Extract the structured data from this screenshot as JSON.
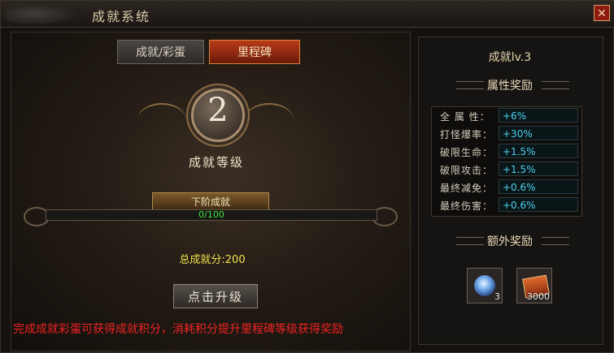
{
  "window": {
    "title": "成就系统",
    "close_glyph": "✕"
  },
  "tabs": [
    {
      "label": "成就/彩蛋",
      "active": false
    },
    {
      "label": "里程碑",
      "active": true
    }
  ],
  "milestone": {
    "level_number": "2",
    "level_label": "成就等级",
    "next_stage_label": "下阶成就",
    "progress_text": "0/100",
    "progress_value": 0,
    "progress_max": 100,
    "total_score_text": "总成就分:200",
    "upgrade_button_label": "点击升级"
  },
  "tip": "完成成就彩蛋可获得成就积分，消耗积分提升里程碑等级获得奖励",
  "right_panel": {
    "rank_title": "成就lv.3",
    "attributes_title": "属性奖励",
    "attributes": [
      {
        "label": "全 属 性：",
        "value": "+6%"
      },
      {
        "label": "打怪爆率：",
        "value": "+30%"
      },
      {
        "label": "破限生命：",
        "value": "+1.5%"
      },
      {
        "label": "破限攻击：",
        "value": "+1.5%"
      },
      {
        "label": "最终减免：",
        "value": "+0.6%"
      },
      {
        "label": "最终伤害：",
        "value": "+0.6%"
      }
    ],
    "extra_title": "额外奖励",
    "rewards": [
      {
        "icon": "orb-icon",
        "count": "3"
      },
      {
        "icon": "scroll-book-icon",
        "count": "3000"
      }
    ]
  },
  "colors": {
    "accent_red": "#ee2323",
    "value_cyan": "#49d2ee",
    "progress_green": "#39e33a",
    "score_yellow": "#f1e04c"
  }
}
